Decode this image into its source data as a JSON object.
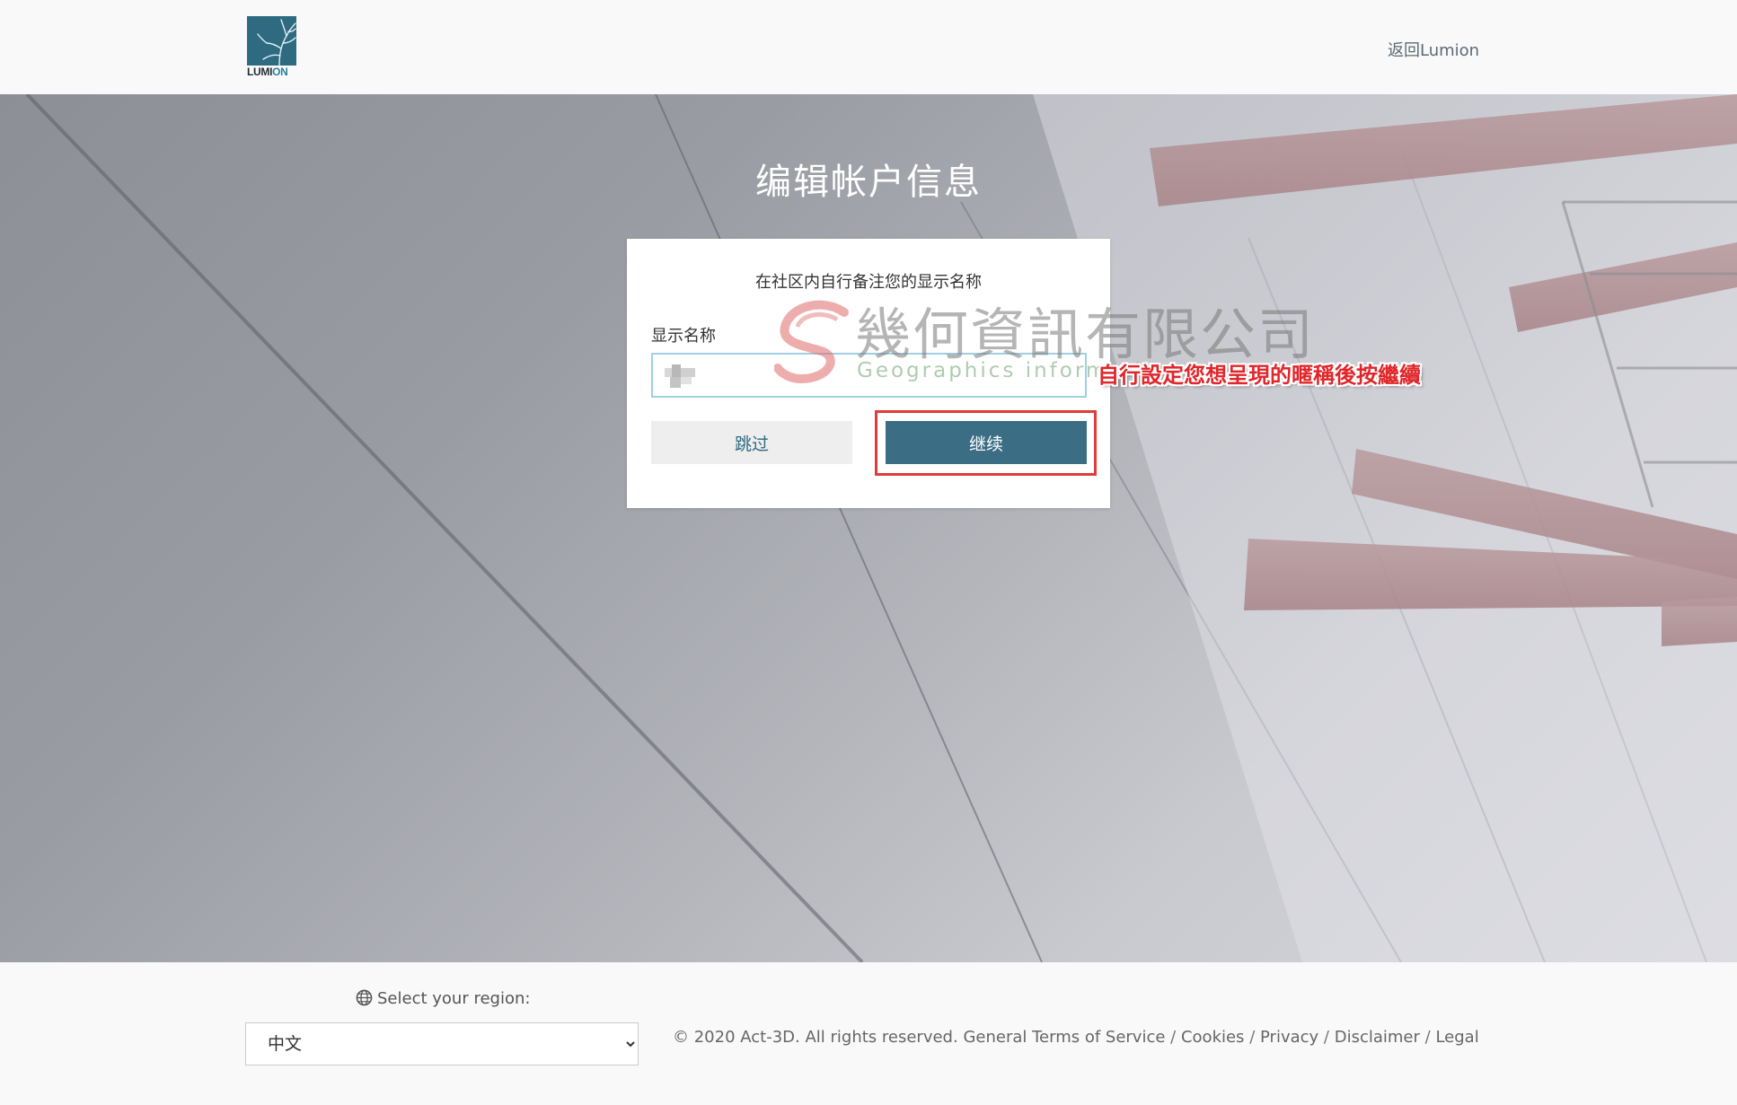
{
  "header": {
    "logo_text_a": "LUMI",
    "logo_text_b": "ON",
    "back_link": "返回Lumion"
  },
  "hero": {
    "title": "编辑帐户信息"
  },
  "dialog": {
    "subtitle": "在社区内自行备注您的显示名称",
    "field_label": "显示名称",
    "field_value": "",
    "skip_label": "跳过",
    "continue_label": "继续"
  },
  "watermark": {
    "title": "幾何資訊有限公司",
    "subtitle": "Geographics information"
  },
  "annotation": {
    "text": "自行設定您想呈現的暱稱後按繼續",
    "color": "#e0262a"
  },
  "footer": {
    "region_label": "Select your region:",
    "region_selected": "中文",
    "copyright": "© 2020 Act-3D. All rights reserved.",
    "links": [
      "General Terms of Service",
      "Cookies",
      "Privacy",
      "Disclaimer",
      "Legal"
    ]
  },
  "colors": {
    "accent": "#3b6e84",
    "highlight": "#e23b3b",
    "input_border": "#9fd0e2"
  }
}
